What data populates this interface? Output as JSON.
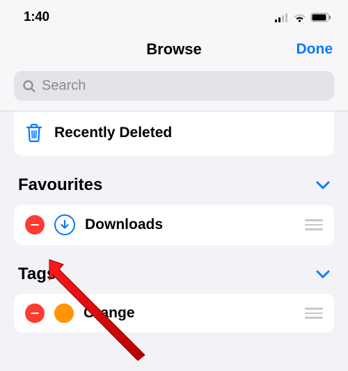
{
  "status_bar": {
    "time": "1:40"
  },
  "header": {
    "title": "Browse",
    "done_label": "Done"
  },
  "search": {
    "placeholder": "Search"
  },
  "locations": {
    "recently_deleted_label": "Recently Deleted"
  },
  "favourites": {
    "title": "Favourites",
    "items": [
      {
        "label": "Downloads",
        "icon": "download-circle-icon"
      }
    ]
  },
  "tags": {
    "title": "Tags",
    "items": [
      {
        "label": "Orange",
        "color": "#ff9500"
      }
    ]
  }
}
